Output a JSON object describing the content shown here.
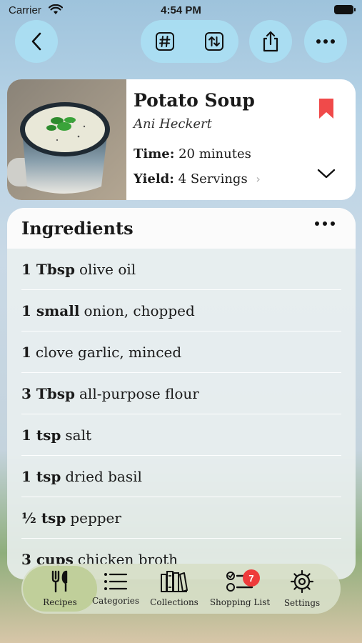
{
  "status_bar": {
    "carrier": "Carrier",
    "time": "4:54 PM"
  },
  "toolbar": {
    "back_icon": "chevron-left-icon",
    "number_icon": "hashtag-icon",
    "convert_icon": "swap-arrows-icon",
    "share_icon": "share-icon",
    "more_icon": "ellipsis-icon"
  },
  "recipe": {
    "title": "Potato Soup",
    "author": "Ani Heckert",
    "time_label": "Time:",
    "time_value": "20 minutes",
    "yield_label": "Yield:",
    "yield_value": "4 Servings",
    "bookmark_color": "#f04a4a"
  },
  "ingredients": {
    "title": "Ingredients",
    "items": [
      {
        "qty": "1 Tbsp",
        "text": "olive oil"
      },
      {
        "qty": "1 small",
        "text": "onion, chopped"
      },
      {
        "qty": "1",
        "text": "clove garlic, minced"
      },
      {
        "qty": "3 Tbsp",
        "text": "all-purpose flour"
      },
      {
        "qty": "1 tsp",
        "text": "salt"
      },
      {
        "qty": "1 tsp",
        "text": "dried basil"
      },
      {
        "qty": "½ tsp",
        "text": "pepper"
      },
      {
        "qty": "3 cups",
        "text": "chicken broth"
      }
    ]
  },
  "tabs": [
    {
      "label": "Recipes",
      "icon": "fork-knife-icon",
      "active": true
    },
    {
      "label": "Categories",
      "icon": "list-icon"
    },
    {
      "label": "Collections",
      "icon": "books-icon"
    },
    {
      "label": "Shopping List",
      "icon": "checklist-icon",
      "badge": "7"
    },
    {
      "label": "Settings",
      "icon": "gear-icon"
    }
  ]
}
